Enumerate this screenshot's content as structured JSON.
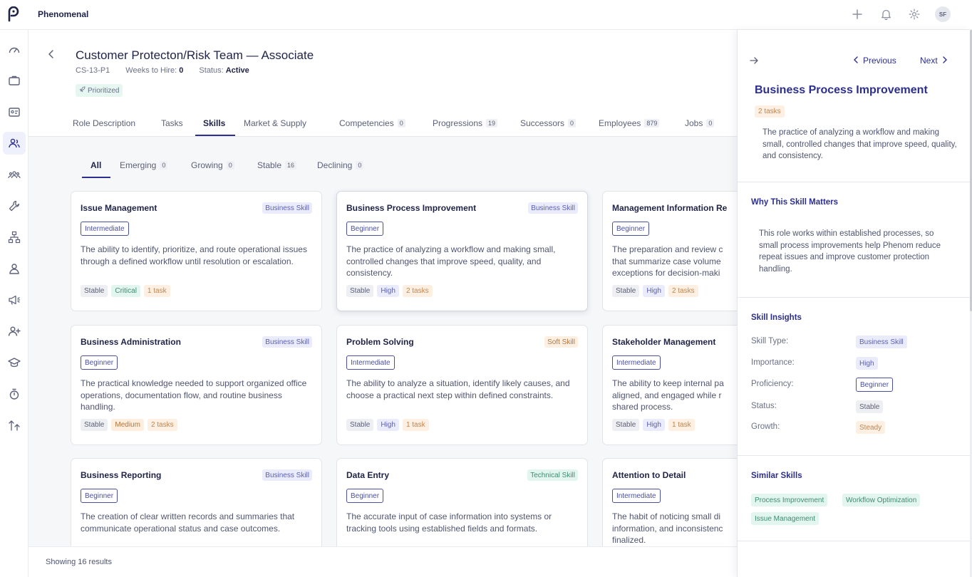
{
  "app": {
    "brand": "Phenomenal",
    "user_initials": "SF"
  },
  "header": {
    "title": "Customer Protecton/Risk Team — Associate",
    "code": "CS-13-P1",
    "weeks_label": "Weeks to Hire:",
    "weeks_value": "0",
    "status_label": "Status:",
    "status_value": "Active",
    "prioritized": "Prioritized"
  },
  "tabs": [
    {
      "label": "Role Description",
      "count": ""
    },
    {
      "label": "Tasks",
      "count": ""
    },
    {
      "label": "Skills",
      "count": ""
    },
    {
      "label": "Market & Supply",
      "count": ""
    },
    {
      "label": "Competencies",
      "count": "0"
    },
    {
      "label": "Progressions",
      "count": "19"
    },
    {
      "label": "Successors",
      "count": "0"
    },
    {
      "label": "Employees",
      "count": "879"
    },
    {
      "label": "Jobs",
      "count": "0"
    }
  ],
  "filters": [
    {
      "label": "All",
      "count": ""
    },
    {
      "label": "Emerging",
      "count": "0"
    },
    {
      "label": "Growing",
      "count": "0"
    },
    {
      "label": "Stable",
      "count": "16"
    },
    {
      "label": "Declining",
      "count": "0"
    }
  ],
  "cards": [
    {
      "title": "Issue Management",
      "type": "Business Skill",
      "level": "Intermediate",
      "desc": "The ability to identify, prioritize, and route operational issues through a defined workflow until resolution or escalation.",
      "status": "Stable",
      "importance": "Critical",
      "tasks": "1 task"
    },
    {
      "title": "Business Process Improvement",
      "type": "Business Skill",
      "level": "Beginner",
      "desc": "The practice of analyzing a workflow and making small, controlled changes that improve speed, quality, and consistency.",
      "status": "Stable",
      "importance": "High",
      "tasks": "2 tasks"
    },
    {
      "title": "Management Information Re",
      "type": "",
      "level": "Beginner",
      "desc": "The preparation and review c that summarize case volume exceptions for decision-maki",
      "status": "Stable",
      "importance": "High",
      "tasks": "2 tasks"
    },
    {
      "title": "Business Administration",
      "type": "Business Skill",
      "level": "Beginner",
      "desc": "The practical knowledge needed to support organized office operations, documentation flow, and routine business handling.",
      "status": "Stable",
      "importance": "Medium",
      "tasks": "2 tasks"
    },
    {
      "title": "Problem Solving",
      "type": "Soft Skill",
      "level": "Intermediate",
      "desc": "The ability to analyze a situation, identify likely causes, and choose a practical next step within defined constraints.",
      "status": "Stable",
      "importance": "High",
      "tasks": "1 task"
    },
    {
      "title": "Stakeholder Management",
      "type": "",
      "level": "Intermediate",
      "desc": "The ability to keep internal pa aligned, and engaged while r shared process.",
      "status": "Stable",
      "importance": "High",
      "tasks": "1 task"
    },
    {
      "title": "Business Reporting",
      "type": "Business Skill",
      "level": "Beginner",
      "desc": "The creation of clear written records and summaries that communicate operational status and case outcomes.",
      "status": "",
      "importance": "",
      "tasks": ""
    },
    {
      "title": "Data Entry",
      "type": "Technical Skill",
      "level": "Beginner",
      "desc": "The accurate input of case information into systems or tracking tools using established fields and formats.",
      "status": "",
      "importance": "",
      "tasks": ""
    },
    {
      "title": "Attention to Detail",
      "type": "",
      "level": "Intermediate",
      "desc": "The habit of noticing small di information, and inconsistenc finalized.",
      "status": "",
      "importance": "",
      "tasks": ""
    }
  ],
  "footer": {
    "text": "Showing 16 results"
  },
  "panel": {
    "previous": "Previous",
    "next": "Next",
    "title": "Business Process Improvement",
    "tasks": "2 tasks",
    "desc": "The practice of analyzing a workflow and making small, controlled changes that improve speed, quality, and consistency.",
    "why_title": "Why This Skill Matters",
    "why_text": "This role works within established processes, so small process improvements help Phenom reduce repeat issues and improve customer protection handling.",
    "insights_title": "Skill Insights",
    "insights": [
      {
        "label": "Skill Type:",
        "value": "Business Skill"
      },
      {
        "label": "Importance:",
        "value": "High"
      },
      {
        "label": "Proficiency:",
        "value": "Beginner"
      },
      {
        "label": "Status:",
        "value": "Stable"
      },
      {
        "label": "Growth:",
        "value": "Steady"
      }
    ],
    "similar_title": "Similar Skills",
    "similar": [
      "Process Improvement",
      "Workflow Optimization",
      "Issue Management"
    ]
  }
}
